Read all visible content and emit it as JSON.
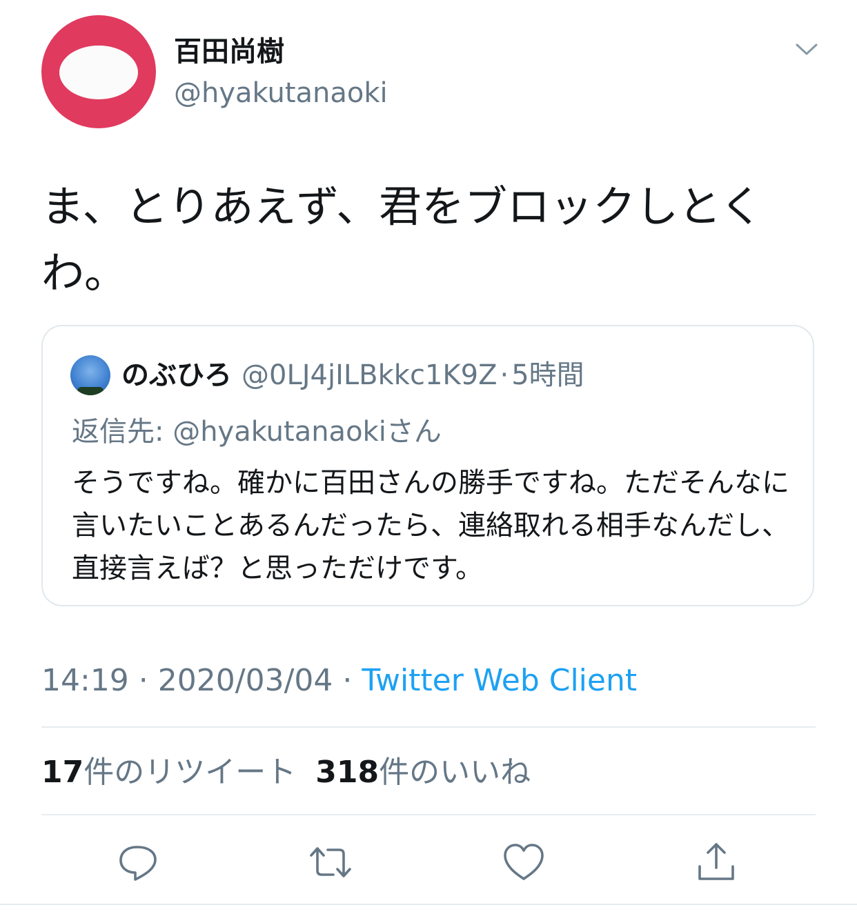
{
  "tweet": {
    "author": {
      "display_name": "百田尚樹",
      "handle": "@hyakutanaoki"
    },
    "text": "ま、とりあえず、君をブロックしとくわ。",
    "quoted": {
      "display_name": "のぶひろ",
      "handle": "@0LJ4jILBkkc1K9Z",
      "separator": "·",
      "time": "5時間",
      "reply_to": "返信先: @hyakutanaokiさん",
      "text": "そうですね。確かに百田さんの勝手ですね。ただそんなに言いたいことあるんだったら、連絡取れる相手なんだし、直接言えば？と思っただけです。"
    },
    "meta": {
      "time": "14:19",
      "sep1": " · ",
      "date": "2020/03/04",
      "sep2": " · ",
      "client": "Twitter Web Client"
    },
    "stats": {
      "retweet_count": "17",
      "retweet_label": "件のリツイート",
      "like_count": "318",
      "like_label": "件のいいね"
    }
  },
  "icons": {
    "menu": "chevron-down-icon",
    "reply": "reply-icon",
    "retweet": "retweet-icon",
    "like": "heart-icon",
    "share": "share-icon"
  },
  "colors": {
    "avatar_bg": "#e03a5e",
    "link": "#1da1f2",
    "secondary_text": "#657786",
    "border": "#e1e8ed"
  }
}
